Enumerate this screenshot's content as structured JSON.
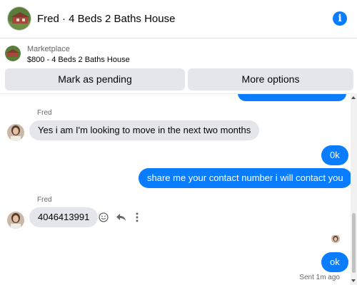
{
  "header": {
    "title": "Fred · 4 Beds 2 Baths House",
    "info_icon": "info-icon"
  },
  "listing": {
    "source": "Marketplace",
    "title": "$800 - 4 Beds 2 Baths House",
    "buttons": {
      "pending": "Mark as pending",
      "more": "More options"
    }
  },
  "thread": {
    "messages": [
      {
        "sender": "Fred",
        "text": "Yes i am I'm looking to move in the next two months",
        "direction": "incoming"
      },
      {
        "text": "0k",
        "direction": "outgoing"
      },
      {
        "text": "share me your contact number i will contact you",
        "direction": "outgoing"
      },
      {
        "sender": "Fred",
        "text": "4046413991",
        "direction": "incoming"
      },
      {
        "text": "ok",
        "direction": "outgoing"
      }
    ],
    "status": "Sent 1m ago"
  },
  "colors": {
    "accent": "#0a7cff",
    "incoming_bubble": "#e4e6eb",
    "secondary_text": "#65676b"
  }
}
